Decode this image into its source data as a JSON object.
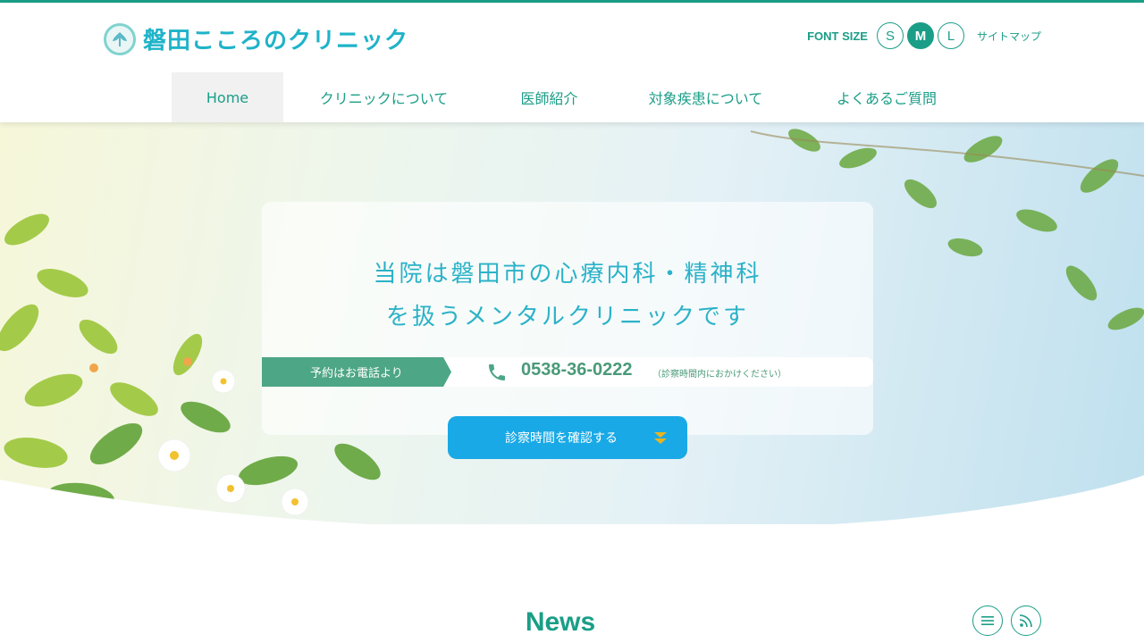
{
  "header": {
    "logo_text": "磐田こころのクリニック",
    "font_size_label": "FONT SIZE",
    "font_sizes": [
      "S",
      "M",
      "L"
    ],
    "font_size_selected": "M",
    "sitemap_label": "サイトマップ"
  },
  "nav": {
    "items": [
      {
        "label": "Home",
        "active": true
      },
      {
        "label": "クリニックについて",
        "active": false
      },
      {
        "label": "医師紹介",
        "active": false
      },
      {
        "label": "対象疾患について",
        "active": false
      },
      {
        "label": "よくあるご質問",
        "active": false
      }
    ]
  },
  "hero": {
    "headline_line1": "当院は磐田市の心療内科・精神科",
    "headline_line2": "を扱うメンタルクリニックです",
    "tel_tag": "予約はお電話より",
    "tel_number": "0538-36-0222",
    "tel_note": "（診察時間内におかけください）",
    "hours_button": "診察時間を確認する"
  },
  "news": {
    "title": "News"
  },
  "colors": {
    "brand_green": "#1a9e87",
    "logo_blue": "#1fb3c9",
    "tel_green": "#4da686",
    "button_blue": "#19a9e6",
    "arrow_gold": "#e8b520"
  },
  "icons": [
    "logo-emblem-icon",
    "phone-icon",
    "double-chevron-down-icon",
    "list-icon",
    "rss-icon"
  ]
}
